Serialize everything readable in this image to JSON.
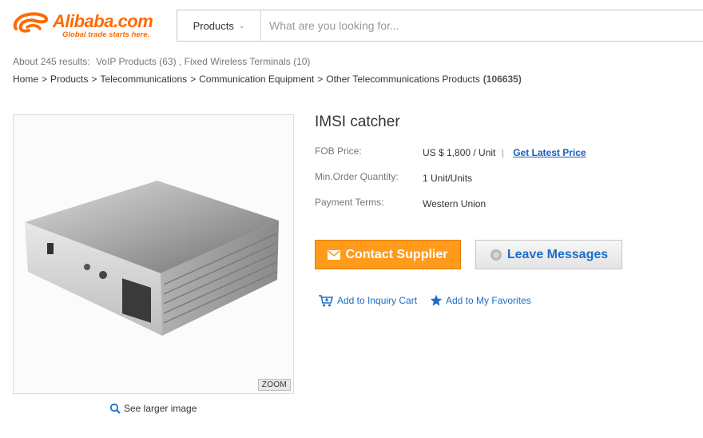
{
  "header": {
    "logo_text": "Alibaba.com",
    "logo_tagline": "Global trade starts here.",
    "search_category": "Products",
    "search_placeholder": "What are you looking for..."
  },
  "results": {
    "summary": "About 245 results:",
    "related": [
      {
        "label": "VoIP Products (63)"
      },
      {
        "label": "Fixed Wireless Terminals (10)"
      }
    ]
  },
  "breadcrumb": {
    "items": [
      "Home",
      "Products",
      "Telecommunications",
      "Communication Equipment",
      "Other Telecommunications Products"
    ],
    "count": "(106635)"
  },
  "product": {
    "title": "IMSI catcher",
    "image_zoom_label": "ZOOM",
    "see_larger": "See larger image",
    "fob_label": "FOB Price:",
    "fob_value": "US $ 1,800 / Unit",
    "fob_separator": "|",
    "get_latest_price": "Get Latest Price",
    "moq_label": "Min.Order Quantity:",
    "moq_value": "1 Unit/Units",
    "payment_label": "Payment Terms:",
    "payment_value": "Western Union"
  },
  "actions": {
    "contact_supplier": "Contact Supplier",
    "leave_messages": "Leave Messages",
    "add_inquiry": "Add to Inquiry Cart",
    "add_favorites": "Add to My Favorites"
  },
  "colors": {
    "brand_orange": "#ff6a00",
    "contact_button": "#ff9a1a",
    "link_blue": "#1a6ec8"
  }
}
